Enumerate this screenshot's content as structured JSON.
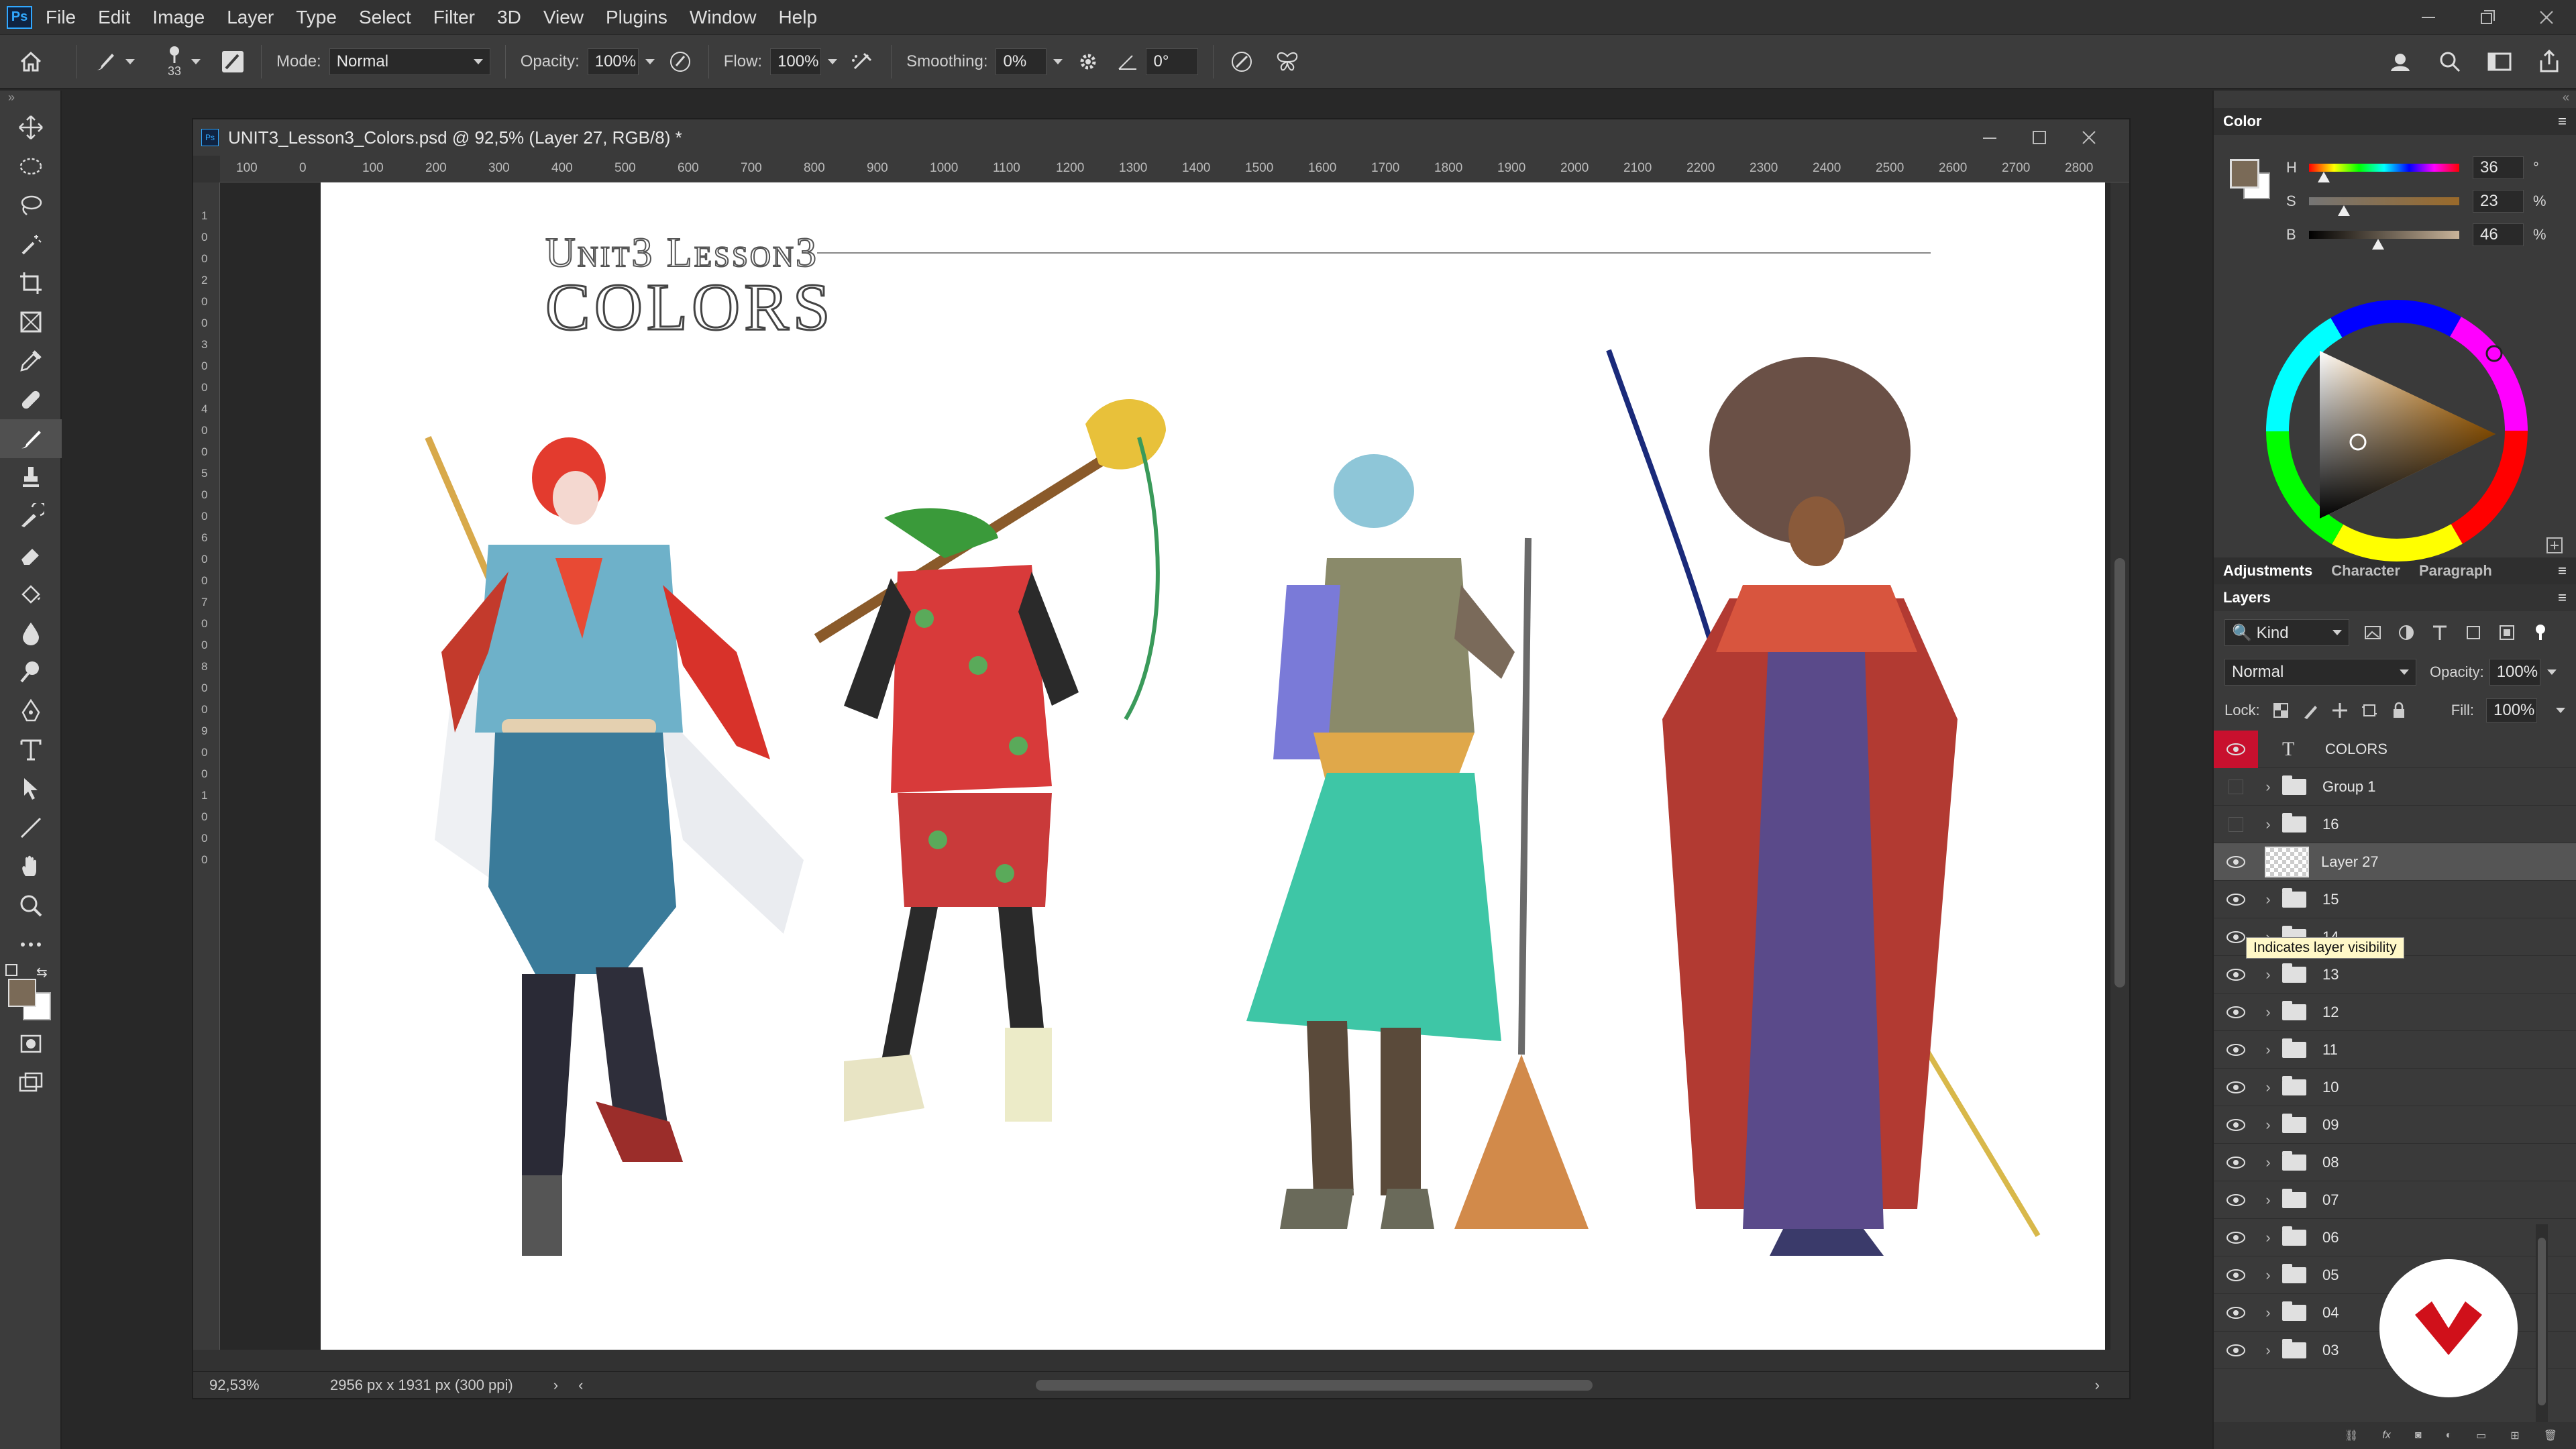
{
  "app": {
    "name": "Photoshop",
    "logo": "Ps"
  },
  "menus": [
    "File",
    "Edit",
    "Image",
    "Layer",
    "Type",
    "Select",
    "Filter",
    "3D",
    "View",
    "Plugins",
    "Window",
    "Help"
  ],
  "options_bar": {
    "brush_size": "33",
    "mode_label": "Mode:",
    "mode_value": "Normal",
    "opacity_label": "Opacity:",
    "opacity_value": "100%",
    "flow_label": "Flow:",
    "flow_value": "100%",
    "smoothing_label": "Smoothing:",
    "smoothing_value": "0%",
    "angle_value": "0°"
  },
  "document": {
    "title": "UNIT3_Lesson3_Colors.psd @ 92,5% (Layer 27, RGB/8) *",
    "ruler_h": [
      "100",
      "0",
      "100",
      "200",
      "300",
      "400",
      "500",
      "600",
      "700",
      "800",
      "900",
      "1000",
      "1100",
      "1200",
      "1300",
      "1400",
      "1500",
      "1600",
      "1700",
      "1800",
      "1900",
      "2000",
      "2100",
      "2200",
      "2300",
      "2400",
      "2500",
      "2600",
      "2700",
      "2800"
    ],
    "ruler_v": [
      "1",
      "0",
      "0",
      "2",
      "0",
      "0",
      "3",
      "0",
      "0",
      "4",
      "0",
      "0",
      "5",
      "0",
      "0",
      "6",
      "0",
      "0",
      "7",
      "0",
      "0",
      "8",
      "0",
      "0",
      "9",
      "0",
      "0",
      "1",
      "0",
      "0",
      "0"
    ],
    "zoom": "92,53%",
    "dimensions": "2956 px x 1931 px (300 ppi)",
    "artwork": {
      "heading_small": "Unit3 Lesson3",
      "heading_large": "COLORS"
    }
  },
  "color_panel": {
    "tab": "Color",
    "sliders": [
      {
        "label": "H",
        "value": "36",
        "unit": "°",
        "level": 0.1
      },
      {
        "label": "S",
        "value": "23",
        "unit": "%",
        "level": 0.23
      },
      {
        "label": "B",
        "value": "46",
        "unit": "%",
        "level": 0.46
      }
    ],
    "foreground": "#7a6a57",
    "background": "#ffffff"
  },
  "adjust_tabs": [
    "Adjustments",
    "Character",
    "Paragraph"
  ],
  "layers_panel": {
    "tab": "Layers",
    "filter_label": "Kind",
    "blend_mode": "Normal",
    "opacity_label": "Opacity:",
    "opacity_value": "100%",
    "lock_label": "Lock:",
    "fill_label": "Fill:",
    "fill_value": "100%",
    "tooltip": "Indicates layer visibility",
    "layers": [
      {
        "name": "COLORS",
        "kind": "text",
        "visible": true
      },
      {
        "name": "Group 1",
        "kind": "group",
        "visible": false
      },
      {
        "name": "16",
        "kind": "group",
        "visible": false
      },
      {
        "name": "Layer 27",
        "kind": "pixel",
        "visible": true,
        "selected": true
      },
      {
        "name": "15",
        "kind": "group",
        "visible": true
      },
      {
        "name": "14",
        "kind": "group",
        "visible": true
      },
      {
        "name": "13",
        "kind": "group",
        "visible": true
      },
      {
        "name": "12",
        "kind": "group",
        "visible": true
      },
      {
        "name": "11",
        "kind": "group",
        "visible": true
      },
      {
        "name": "10",
        "kind": "group",
        "visible": true
      },
      {
        "name": "09",
        "kind": "group",
        "visible": true
      },
      {
        "name": "08",
        "kind": "group",
        "visible": true
      },
      {
        "name": "07",
        "kind": "group",
        "visible": true
      },
      {
        "name": "06",
        "kind": "group",
        "visible": true
      },
      {
        "name": "05",
        "kind": "group",
        "visible": true
      },
      {
        "name": "04",
        "kind": "group",
        "visible": true
      },
      {
        "name": "03",
        "kind": "group",
        "visible": true
      }
    ]
  },
  "colors": {
    "accent": "#c8102e",
    "panel": "#3a3a3a",
    "selected_layer": "#555555"
  }
}
